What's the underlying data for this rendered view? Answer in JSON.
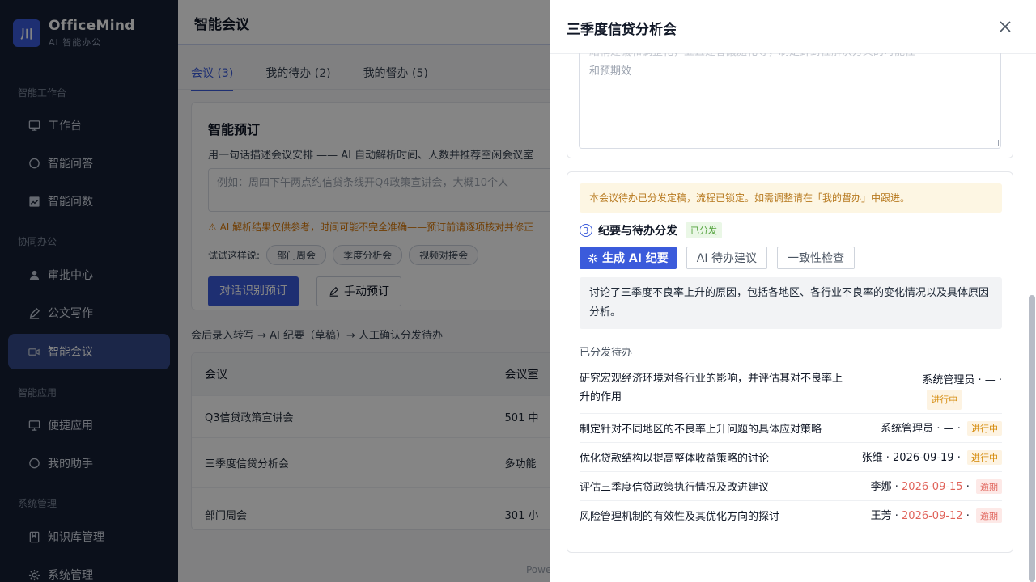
{
  "brand": {
    "logo": "川",
    "name": "OfficeMind",
    "sub": "AI 智能办公"
  },
  "sidebar": {
    "sections": [
      "智能工作台",
      "协同办公",
      "智能应用",
      "系统管理"
    ],
    "items": [
      {
        "label": "工作台",
        "icon": "monitor-icon"
      },
      {
        "label": "智能问答",
        "icon": "chat-icon"
      },
      {
        "label": "智能问数",
        "icon": "chart-icon"
      },
      {
        "label": "审批中心",
        "icon": "user-icon"
      },
      {
        "label": "公文写作",
        "icon": "pen-icon"
      },
      {
        "label": "智能会议",
        "icon": "video-icon"
      },
      {
        "label": "便捷应用",
        "icon": "monitor-icon"
      },
      {
        "label": "我的助手",
        "icon": "chat-icon"
      },
      {
        "label": "知识库管理",
        "icon": "book-icon"
      },
      {
        "label": "系统管理",
        "icon": "gear-icon"
      }
    ]
  },
  "header": {
    "title": "智能会议"
  },
  "tabs": [
    "会议 (3)",
    "我的待办 (2)",
    "我的督办 (5)"
  ],
  "booking": {
    "title": "智能预订",
    "desc": "用一句话描述会议安排 —— AI 自动解析时间、人数并推荐空闲会议室",
    "placeholder": "例如：周四下午两点约信贷条线开Q4政策宣讲会，大概10个人",
    "warning": "⚠ AI 解析结果仅供参考，时间可能不完全准确——预订前请逐项核对并修正",
    "try_label": "试试这样说:",
    "chips": [
      "部门周会",
      "季度分析会",
      "视频对接会"
    ],
    "btn_primary": "对话识别预订",
    "btn_manual": "手动预订"
  },
  "flow_text": "会后录入转写 → AI 纪要（草稿）→ 人工确认分发待办",
  "table": {
    "headers": [
      "会议",
      "会议室"
    ],
    "rows": [
      [
        "Q3信贷政策宣讲会",
        "501 中"
      ],
      [
        "三季度信贷分析会",
        "多功能"
      ],
      [
        "部门周会",
        "301 小"
      ]
    ]
  },
  "footer_text": "Powe",
  "drawer": {
    "title": "三季度信贷分析会",
    "prev_clip": "結構建議和調整化，並且建會議處化等，制定針對性解決方案的可能性",
    "prev_tail": "和预期效",
    "notice": "本会议待办已分发定稿，流程已锁定。如需调整请在「我的督办」中跟进。",
    "step_num": "3",
    "step_title": "纪要与待办分发",
    "step_tag": "已分发",
    "ai_buttons": {
      "generate": "生成 AI 纪要",
      "suggest": "AI 待办建议",
      "check": "一致性检查"
    },
    "summary": "讨论了三季度不良率上升的原因，包括各地区、各行业不良率的变化情况以及具体原因分析。",
    "dist_label": "已分发待办",
    "todos": [
      {
        "text_l1": "研究宏观经济环境对各行业的影响，并评估其对不良率上",
        "text_l2": "升的作用",
        "owner": "系统管理员",
        "date": "—",
        "status": "进行中",
        "overdue": false
      },
      {
        "text_l1": "制定针对不同地区的不良率上升问题的具体应对策略",
        "owner": "系统管理员",
        "date": "—",
        "status": "进行中",
        "overdue": false
      },
      {
        "text_l1": "优化贷款结构以提高整体收益策略的讨论",
        "owner": "张维",
        "date": "2026-09-19",
        "status": "进行中",
        "overdue": false
      },
      {
        "text_l1": "评估三季度信贷政策执行情况及改进建议",
        "owner": "李娜",
        "date": "2026-09-15",
        "status": "逾期",
        "overdue": true
      },
      {
        "text_l1": "风险管理机制的有效性及其优化方向的探讨",
        "owner": "王芳",
        "date": "2026-09-12",
        "status": "逾期",
        "overdue": true
      }
    ]
  },
  "colors": {
    "accent": "#3b5bdb",
    "sidebar": "#162034",
    "warn": "#d97706",
    "overdue": "#e0635a",
    "progress": "#d48806"
  }
}
